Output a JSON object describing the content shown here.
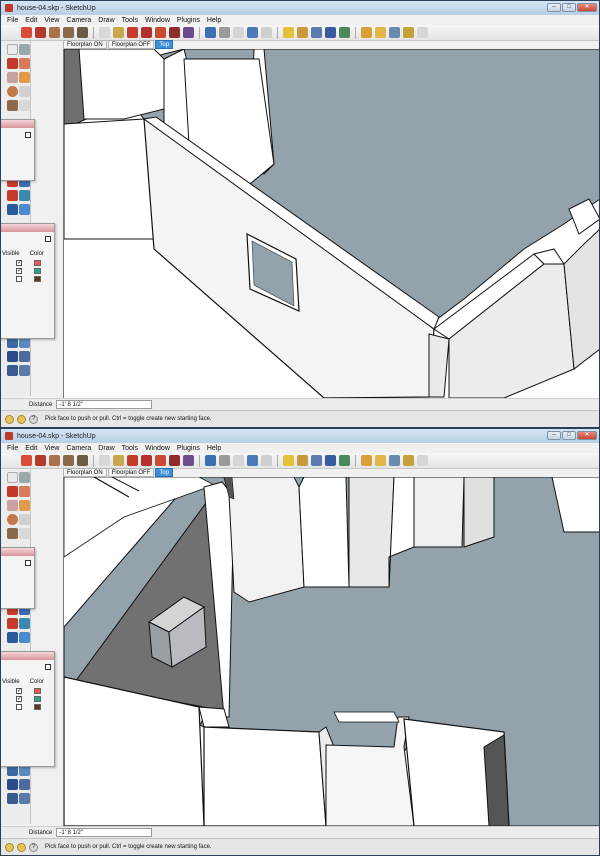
{
  "window": {
    "title": "house-04.skp - SketchUp",
    "controls": {
      "minimize": "–",
      "maximize": "□",
      "close": "✕"
    }
  },
  "menu": [
    "File",
    "Edit",
    "View",
    "Camera",
    "Draw",
    "Tools",
    "Window",
    "Plugins",
    "Help"
  ],
  "scenes": {
    "tabs": [
      "Floorplan ON",
      "Floorplan OFF",
      "Top"
    ],
    "active": "Top"
  },
  "layers": {
    "headers": {
      "visible": "Visible",
      "color": "Color"
    },
    "rows": [
      {
        "visible": true,
        "color": "#e85a5a"
      },
      {
        "visible": true,
        "color": "#2aa88a"
      },
      {
        "visible": false,
        "color": "#5a3a1a"
      }
    ]
  },
  "measurements": {
    "label": "Distance",
    "value": "-1' 8 1/2\""
  },
  "status": {
    "hint": "Pick face to push or pull.  Ctrl = toggle create new starting face."
  },
  "colors": {
    "floor": "#94a2ab",
    "wall": "#ffffff",
    "wall_shade": "#e6e6e6",
    "wall_dark": "#707070",
    "active_tab": "#3c8fd8"
  },
  "icons": {
    "toolbar": [
      "select-arrow-icon",
      "pencil-icon",
      "rectangle-icon",
      "circle-icon",
      "arc-icon",
      "eraser-icon",
      "paint-bucket-icon",
      "push-pull-icon",
      "move-icon",
      "rotate-icon",
      "offset-icon",
      "follow-me-icon",
      "tape-measure-icon",
      "dimension-icon",
      "protractor-icon",
      "text-icon",
      "axes-icon",
      "3d-text-icon",
      "orbit-icon",
      "pan-icon",
      "zoom-icon",
      "zoom-window-icon",
      "zoom-extents-icon",
      "walk-icon",
      "position-camera-icon",
      "look-around-icon",
      "section-plane-icon",
      "shadow-icon",
      "component-icon",
      "3d-warehouse-icon"
    ]
  }
}
